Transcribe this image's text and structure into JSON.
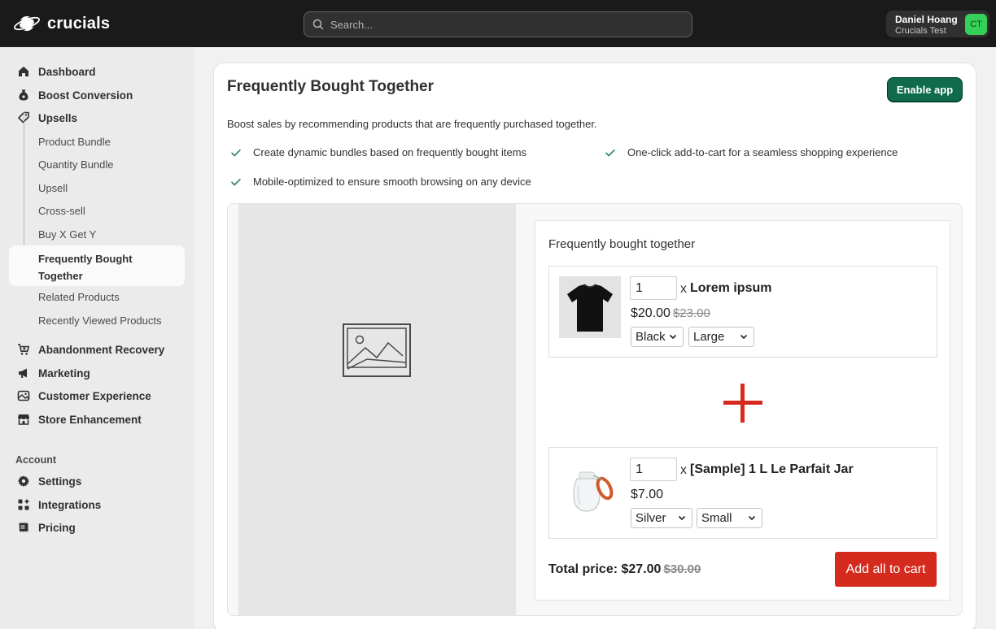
{
  "app": {
    "brand": "crucials"
  },
  "search": {
    "placeholder": "Search..."
  },
  "user": {
    "name": "Daniel Hoang",
    "store": "Crucials Test",
    "initials": "CT"
  },
  "sidebar": {
    "items": [
      {
        "label": "Dashboard",
        "icon": "home-icon"
      },
      {
        "label": "Boost Conversion",
        "icon": "money-bag-icon"
      },
      {
        "label": "Upsells",
        "icon": "tag-icon"
      }
    ],
    "upsell_children": [
      "Product Bundle",
      "Quantity Bundle",
      "Upsell",
      "Cross-sell",
      "Buy X Get Y",
      "Frequently Bought Together",
      "Related Products",
      "Recently Viewed Products"
    ],
    "active": "Frequently Bought Together",
    "more_items": [
      {
        "label": "Abandonment Recovery",
        "icon": "cart-x-icon"
      },
      {
        "label": "Marketing",
        "icon": "megaphone-icon"
      },
      {
        "label": "Customer Experience",
        "icon": "image-icon"
      },
      {
        "label": "Store Enhancement",
        "icon": "store-icon"
      }
    ],
    "account_heading": "Account",
    "account_items": [
      {
        "label": "Settings",
        "icon": "gear-icon"
      },
      {
        "label": "Integrations",
        "icon": "apps-icon"
      },
      {
        "label": "Pricing",
        "icon": "receipt-icon"
      }
    ]
  },
  "page": {
    "title": "Frequently Bought Together",
    "enable_label": "Enable app",
    "description": "Boost sales by recommending products that are frequently purchased together.",
    "features": [
      "Create dynamic bundles based on frequently bought items",
      "One-click add-to-cart for a seamless shopping experience",
      "Mobile-optimized to ensure smooth browsing on any device"
    ]
  },
  "widget": {
    "title": "Frequently bought together",
    "products": [
      {
        "qty": "1",
        "name": "Lorem ipsum",
        "price": "$20.00",
        "old_price": "$23.00",
        "option1": "Black",
        "option2": "Large"
      },
      {
        "qty": "1",
        "name": "[Sample] 1 L Le Parfait Jar",
        "price": "$7.00",
        "old_price": "",
        "option1": "Silver",
        "option2": "Small"
      }
    ],
    "total_label": "Total price: $27.00",
    "total_old": "$30.00",
    "add_label": "Add all to cart",
    "accent_color": "#d42b1e"
  },
  "colors": {
    "primary_button": "#0f6b4b",
    "topbar": "#1a1a1a"
  }
}
